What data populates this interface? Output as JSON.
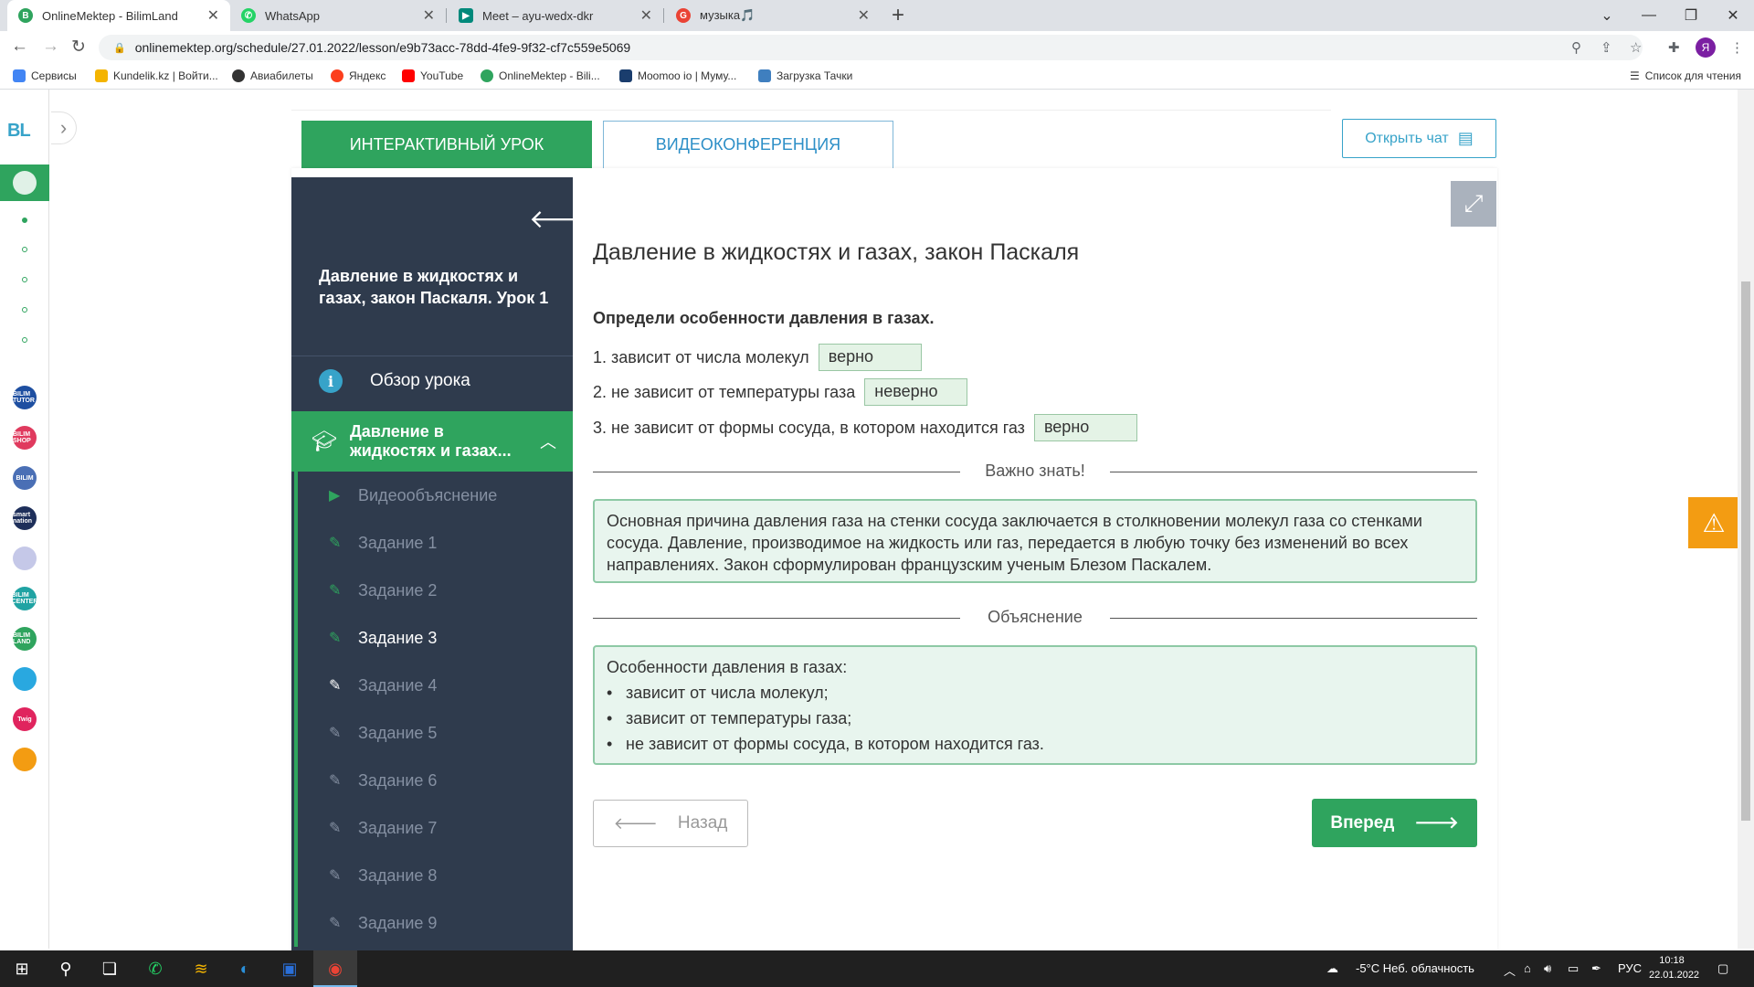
{
  "browser": {
    "tabs": [
      {
        "title": "OnlineMektep - BilimLand",
        "icon": "bilimland-icon",
        "color": "#2fa45e"
      },
      {
        "title": "WhatsApp",
        "icon": "whatsapp-icon",
        "color": "#25d366"
      },
      {
        "title": "Meet – ayu-wedx-dkr",
        "icon": "google-meet-icon",
        "color": "#00897b"
      },
      {
        "title": "музыка🎵",
        "icon": "google-search-icon",
        "color": "#ea4335"
      }
    ],
    "url": "onlinemektep.org/schedule/27.01.2022/lesson/e9b73acc-78dd-4fe9-9f32-cf7c559e5069",
    "profile_initial": "Я",
    "bookmarks": [
      {
        "label": "Сервисы",
        "color": "#4285f4"
      },
      {
        "label": "Kundelik.kz | Войти...",
        "color": "#f4b400"
      },
      {
        "label": "Авиабилеты",
        "color": "#333333"
      },
      {
        "label": "Яндекс",
        "color": "#fc3f1d"
      },
      {
        "label": "YouTube",
        "color": "#ff0000"
      },
      {
        "label": "OnlineMektep - Bili...",
        "color": "#2fa45e"
      },
      {
        "label": "Moomoo io | Муму...",
        "color": "#1a3d6d"
      },
      {
        "label": "Загрузка Тачки",
        "color": "#3f7fbf"
      }
    ],
    "reading_list": "Список для чтения"
  },
  "app_sidebar": {
    "logo": "BL",
    "apps": [
      {
        "label": "BILIM TUTOR",
        "color": "#1e4fa1"
      },
      {
        "label": "BILIM SHOP",
        "color": "#e03a5e"
      },
      {
        "label": "BILIM",
        "color": "#4a6fb5"
      },
      {
        "label": "smart nation",
        "color": "#1e2f5a"
      },
      {
        "label": "",
        "color": "#c5c8e8"
      },
      {
        "label": "BILIM CENTER",
        "color": "#1fa3a3"
      },
      {
        "label": "BILIM LAND",
        "color": "#2fa45e"
      },
      {
        "label": "",
        "color": "#29a8e0"
      },
      {
        "label": "Twig",
        "color": "#e0245e"
      },
      {
        "label": "",
        "color": "#f39c12"
      }
    ]
  },
  "tabs": {
    "interactive": "ИНТЕРАКТИВНЫЙ УРОК",
    "video": "ВИДЕОКОНФЕРЕНЦИЯ",
    "open_chat": "Открыть чат"
  },
  "lesson": {
    "title": "Давление в жидкостях и газах, закон Паскаля. Урок 1",
    "overview": "Обзор урока",
    "section": "Давление в жидкостях и газах...",
    "items": [
      {
        "label": "Видеообъяснение",
        "state": "done",
        "icon": "play-icon"
      },
      {
        "label": "Задание 1",
        "state": "done",
        "icon": "edit-icon"
      },
      {
        "label": "Задание 2",
        "state": "done",
        "icon": "edit-icon"
      },
      {
        "label": "Задание 3",
        "state": "current",
        "icon": "edit-icon"
      },
      {
        "label": "Задание 4",
        "state": "pending",
        "icon": "edit-icon"
      },
      {
        "label": "Задание 5",
        "state": "locked",
        "icon": "edit-icon"
      },
      {
        "label": "Задание 6",
        "state": "locked",
        "icon": "edit-icon"
      },
      {
        "label": "Задание 7",
        "state": "locked",
        "icon": "edit-icon"
      },
      {
        "label": "Задание 8",
        "state": "locked",
        "icon": "edit-icon"
      },
      {
        "label": "Задание 9",
        "state": "locked",
        "icon": "edit-icon"
      }
    ]
  },
  "task": {
    "title": "Давление в жидкостях и газах, закон Паскаля",
    "question": "Определи особенности давления в газах.",
    "statements": [
      {
        "text": "1. зависит от числа молекул",
        "answer": "верно"
      },
      {
        "text": "2. не зависит от температуры газа",
        "answer": "неверно"
      },
      {
        "text": "3. не зависит от формы сосуда, в котором находится газ",
        "answer": "верно"
      }
    ],
    "important_heading": "Важно знать!",
    "important_text": "Основная причина давления газа на стенки сосуда заключается в столкновении молекул газа со стенками сосуда. Давление, производимое на жидкость или газ, передается в любую точку без изменений во всех направлениях. Закон сформулирован французским ученым Блезом Паскалем.",
    "explanation_heading": "Объяснение",
    "explanation_intro": "Особенности давления в газах:",
    "explanation_items": [
      "зависит от числа молекул;",
      "зависит от температуры газа;",
      "не зависит от формы сосуда, в котором находится газ."
    ],
    "back": "Назад",
    "next": "Вперед"
  },
  "taskbar": {
    "weather": "-5°C  Неб. облачность",
    "lang": "РУС",
    "time": "10:18",
    "date": "22.01.2022"
  }
}
